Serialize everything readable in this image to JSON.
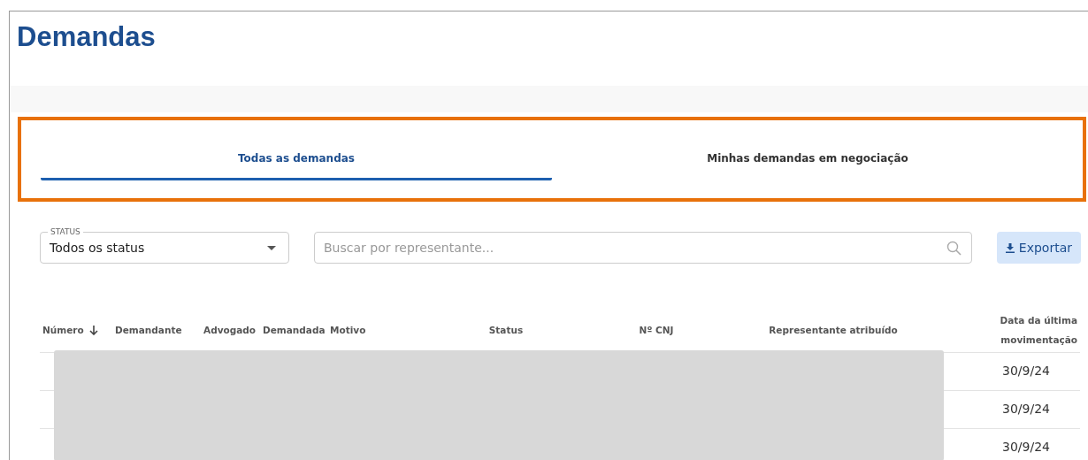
{
  "page": {
    "title": "Demandas"
  },
  "tabs": [
    {
      "label": "Todas as demandas",
      "selected": true
    },
    {
      "label": "Minhas demandas em negociação",
      "selected": false
    }
  ],
  "filters": {
    "status_label": "STATUS",
    "status_value": "Todos os status",
    "search": {
      "placeholder": "Buscar por representante..."
    },
    "export_button": "Exportar"
  },
  "table": {
    "columns": [
      {
        "label": "Número",
        "sorted": true
      },
      {
        "label": "Demandante",
        "sorted": false
      },
      {
        "label": "Advogado",
        "sorted": false
      },
      {
        "label": "Demandada",
        "sorted": false
      },
      {
        "label": "Motivo",
        "sorted": false
      },
      {
        "label": "Status",
        "sorted": false
      },
      {
        "label": "Nº CNJ",
        "sorted": false
      },
      {
        "label": "Representante atribuído",
        "sorted": false
      },
      {
        "label": "Data da última movimentação",
        "sorted": false
      }
    ],
    "rows": [
      {
        "date": "30/9/24"
      },
      {
        "date": "30/9/24"
      },
      {
        "date": "30/9/24"
      }
    ]
  }
}
